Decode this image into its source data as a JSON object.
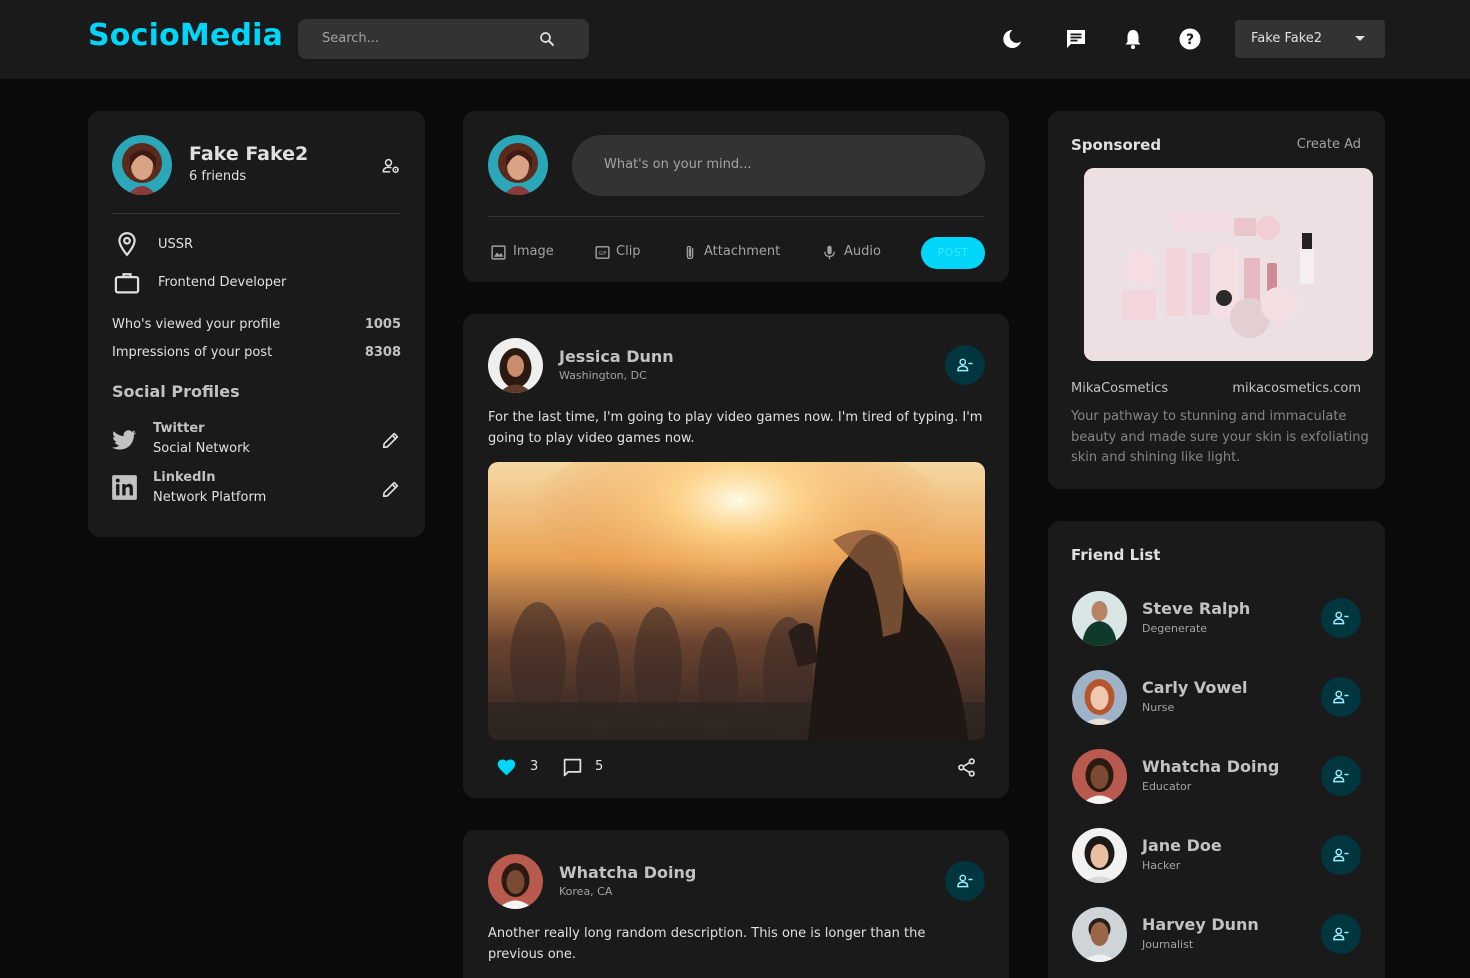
{
  "header": {
    "logo": "SocioMedia",
    "search_placeholder": "Search...",
    "user_name": "Fake Fake2",
    "icons": [
      "moon-icon",
      "message-icon",
      "bell-icon",
      "help-icon"
    ]
  },
  "profile": {
    "name": "Fake Fake2",
    "friends": "6 friends",
    "location": "USSR",
    "occupation": "Frontend Developer",
    "stats": [
      {
        "label": "Who's viewed your profile",
        "value": "1005"
      },
      {
        "label": "Impressions of your post",
        "value": "8308"
      }
    ],
    "social_title": "Social Profiles",
    "socials": [
      {
        "name": "Twitter",
        "type": "Social Network"
      },
      {
        "name": "LinkedIn",
        "type": "Network Platform"
      }
    ]
  },
  "composer": {
    "placeholder": "What's on your mind...",
    "tools": [
      "Image",
      "Clip",
      "Attachment",
      "Audio"
    ],
    "post_label": "POST"
  },
  "posts": [
    {
      "name": "Jessica Dunn",
      "location": "Washington, DC",
      "description": "For the last time, I'm going to play video games now. I'm tired of typing. I'm going to play video games now.",
      "likes": "3",
      "comments": "5"
    },
    {
      "name": "Whatcha Doing",
      "location": "Korea, CA",
      "description": "Another really long random description. This one is longer than the previous one."
    }
  ],
  "sponsored": {
    "title": "Sponsored",
    "create_ad": "Create Ad",
    "name": "MikaCosmetics",
    "url": "mikacosmetics.com",
    "description": "Your pathway to stunning and immaculate beauty and made sure your skin is exfoliating skin and shining like light."
  },
  "friend_list": {
    "title": "Friend List",
    "friends": [
      {
        "name": "Steve Ralph",
        "occupation": "Degenerate"
      },
      {
        "name": "Carly Vowel",
        "occupation": "Nurse"
      },
      {
        "name": "Whatcha Doing",
        "occupation": "Educator"
      },
      {
        "name": "Jane Doe",
        "occupation": "Hacker"
      },
      {
        "name": "Harvey Dunn",
        "occupation": "Journalist"
      }
    ]
  },
  "colors": {
    "accent": "#00d5fa",
    "background": "#0a0a0a",
    "card": "#1a1a1a",
    "input": "#333333",
    "friend_button": "#01363f"
  }
}
